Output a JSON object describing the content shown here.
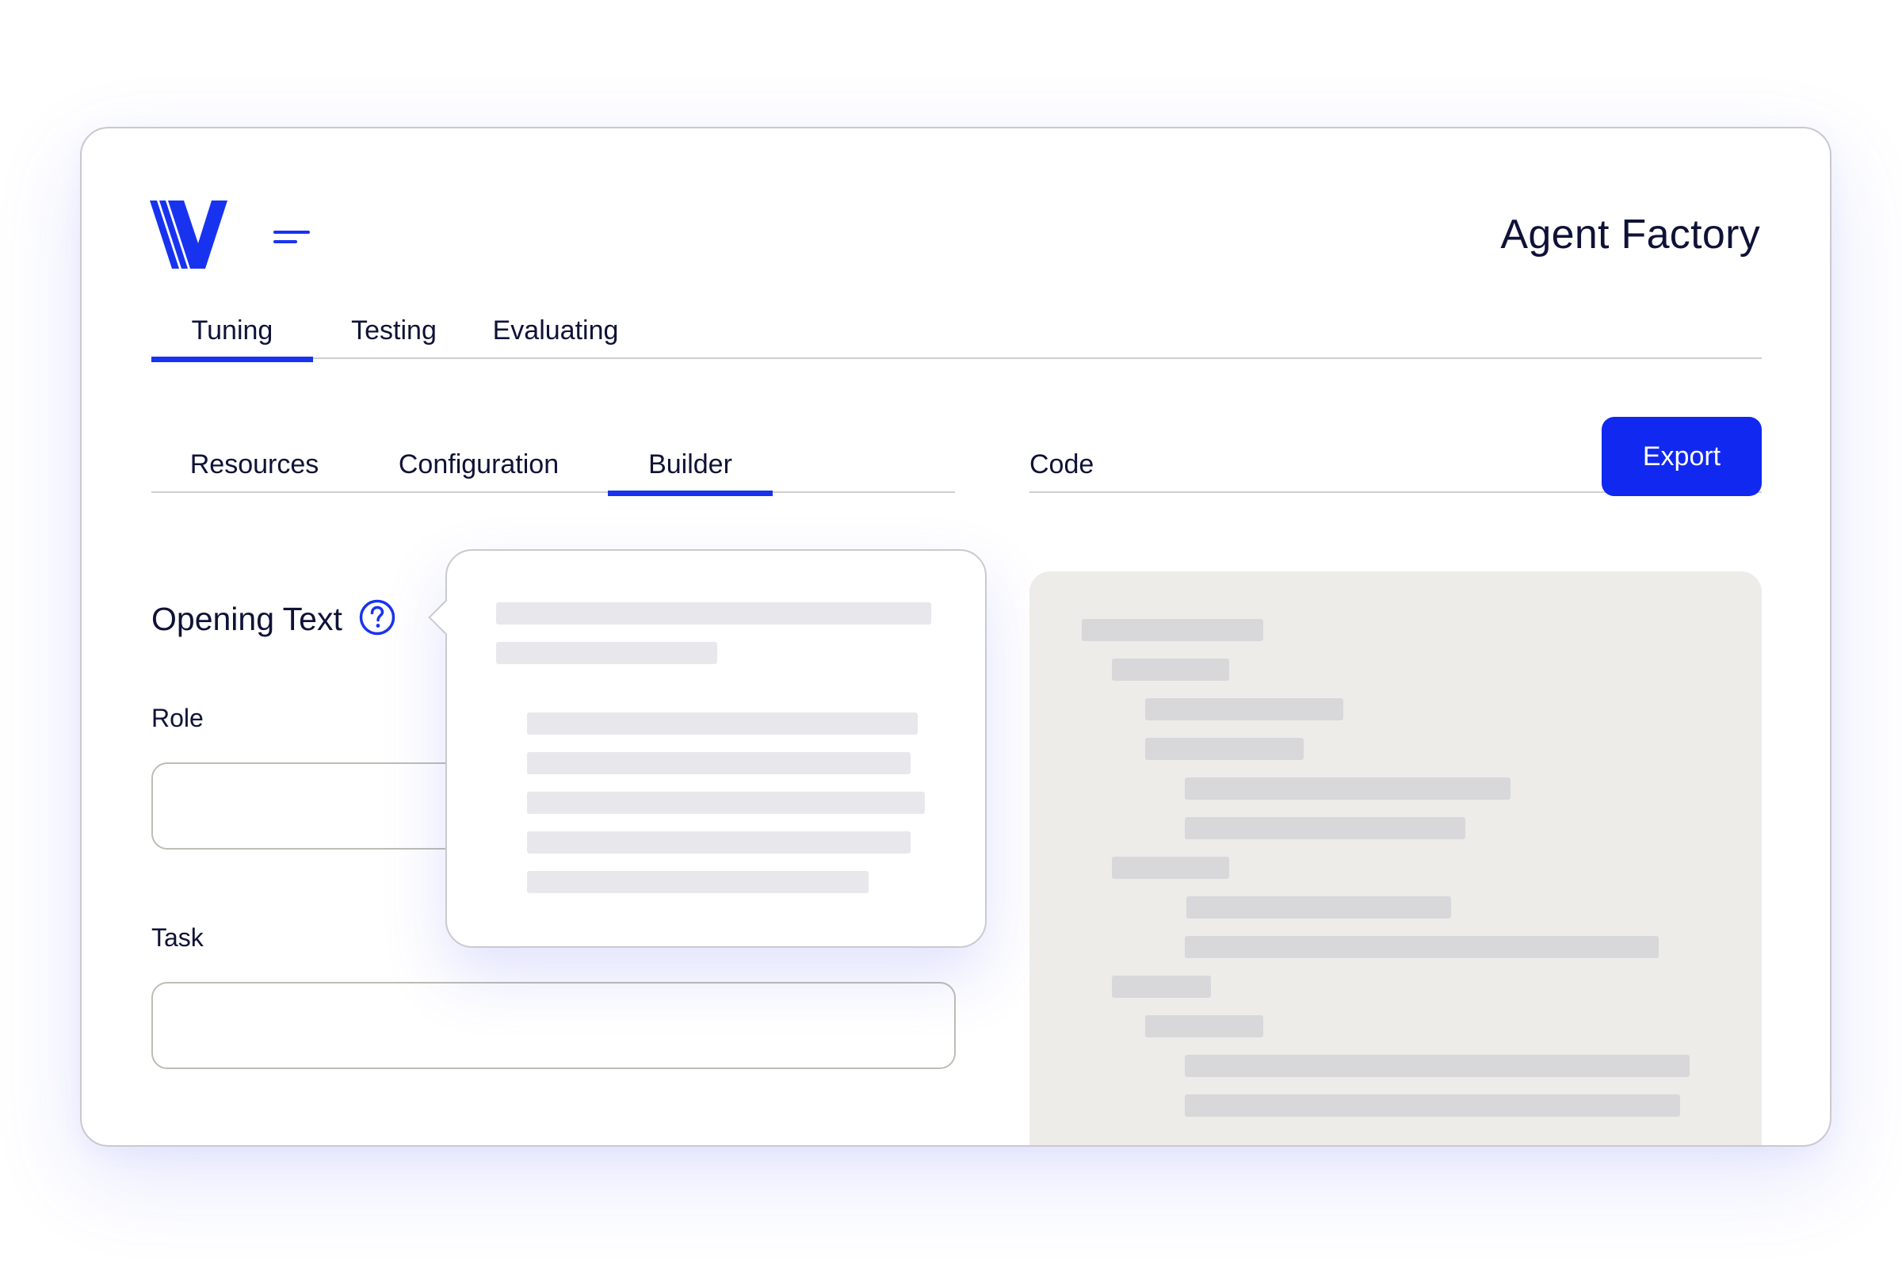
{
  "header": {
    "logo_letter": "V",
    "app_title": "Agent Factory"
  },
  "main_tabs": [
    {
      "label": "Tuning",
      "active": true
    },
    {
      "label": "Testing",
      "active": false
    },
    {
      "label": "Evaluating",
      "active": false
    }
  ],
  "sub_tabs": [
    {
      "label": "Resources",
      "active": false
    },
    {
      "label": "Configuration",
      "active": false
    },
    {
      "label": "Builder",
      "active": true
    }
  ],
  "code_panel": {
    "tab_label": "Code",
    "export_label": "Export"
  },
  "form": {
    "section_title": "Opening Text",
    "help_icon": "question-circle-icon",
    "role_label": "Role",
    "role_value": "",
    "task_label": "Task",
    "task_value": ""
  },
  "icons": {
    "menu": "menu-icon",
    "help": "question-circle-icon",
    "logo": "logo-v-icon"
  },
  "colors": {
    "accent": "#1833f0",
    "button": "#1028ef",
    "text": "#0f1237",
    "code_panel_bg": "#edece9",
    "skeleton": "#e7e7ec"
  }
}
